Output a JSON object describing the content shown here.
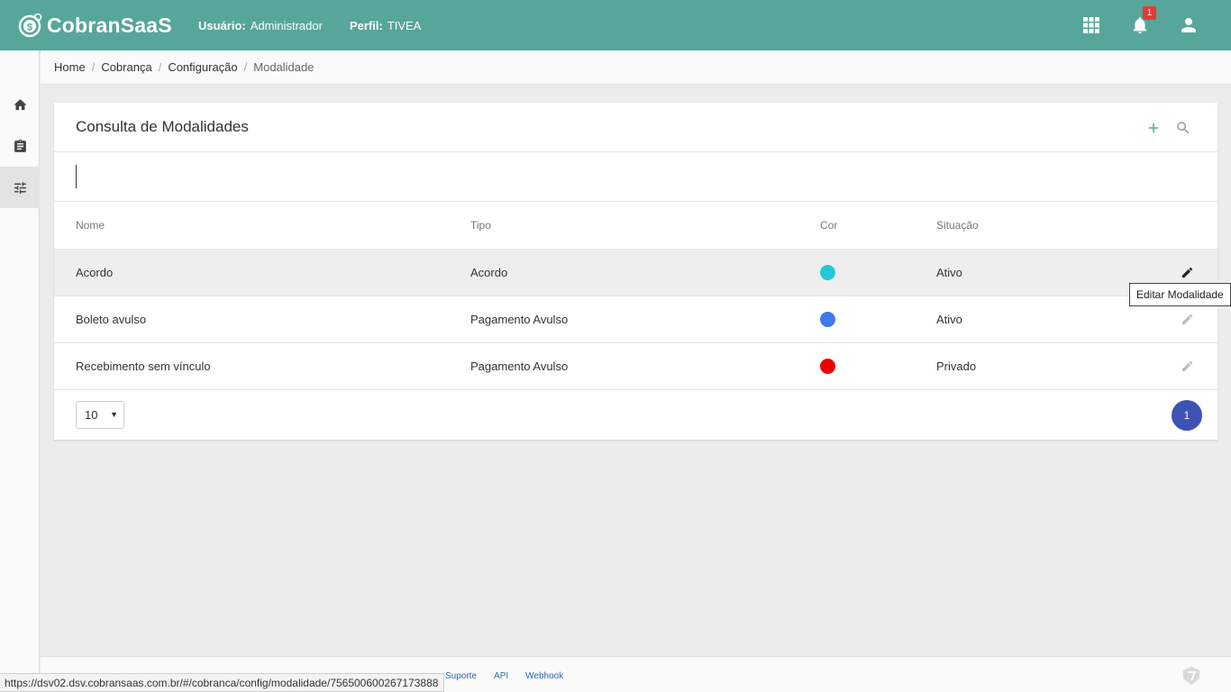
{
  "header": {
    "brand": "CobranSaaS",
    "user_label": "Usuário:",
    "user_value": "Administrador",
    "profile_label": "Perfil:",
    "profile_value": "TIVEA",
    "notification_count": "1",
    "icons": [
      "apps-grid-icon",
      "bell-icon",
      "account-icon"
    ]
  },
  "sidebar": {
    "items": [
      {
        "icon": "home-icon"
      },
      {
        "icon": "clipboard-icon"
      },
      {
        "icon": "sliders-icon",
        "active": true
      }
    ]
  },
  "breadcrumb": [
    "Home",
    "Cobrança",
    "Configuração",
    "Modalidade"
  ],
  "card": {
    "title": "Consulta de Modalidades",
    "search_value": "",
    "columns": [
      "Nome",
      "Tipo",
      "Cor",
      "Situação"
    ],
    "rows": [
      {
        "nome": "Acordo",
        "tipo": "Acordo",
        "cor": "#26c6da",
        "situacao": "Ativo"
      },
      {
        "nome": "Boleto avulso",
        "tipo": "Pagamento Avulso",
        "cor": "#3d7be8",
        "situacao": "Ativo"
      },
      {
        "nome": "Recebimento sem vínculo",
        "tipo": "Pagamento Avulso",
        "cor": "#ee0000",
        "situacao": "Privado"
      }
    ],
    "page_size": "10",
    "current_page": "1"
  },
  "tooltip": "Editar Modalidade",
  "footer": {
    "links": [
      "Suporte",
      "API",
      "Webhook"
    ]
  },
  "status_url": "https://dsv02.dsv.cobransaas.com.br/#/cobranca/config/modalidade/756500600267173888",
  "colors": {
    "topbar": "#56a699",
    "page_button": "#3f51b5",
    "badge": "#e53935"
  }
}
